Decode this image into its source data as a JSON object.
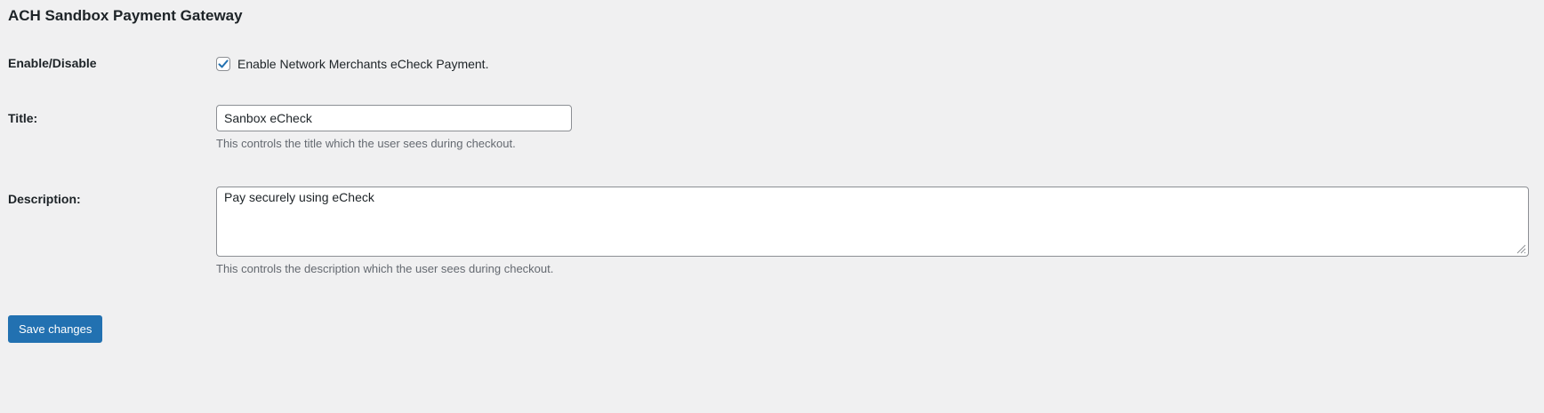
{
  "section": {
    "title": "ACH Sandbox Payment Gateway"
  },
  "fields": {
    "enable": {
      "label": "Enable/Disable",
      "checked": true,
      "checkbox_label": "Enable Network Merchants eCheck Payment."
    },
    "title": {
      "label": "Title:",
      "value": "Sanbox eCheck",
      "help": "This controls the title which the user sees during checkout."
    },
    "description": {
      "label": "Description:",
      "value": "Pay securely using eCheck",
      "help": "This controls the description which the user sees during checkout."
    }
  },
  "actions": {
    "save_label": "Save changes"
  },
  "colors": {
    "accent": "#2271b1",
    "background": "#f0f0f1",
    "help_text": "#646970"
  },
  "icons": {
    "checkbox": "checkmark-icon",
    "textarea_resize": "resize-grip-icon"
  }
}
